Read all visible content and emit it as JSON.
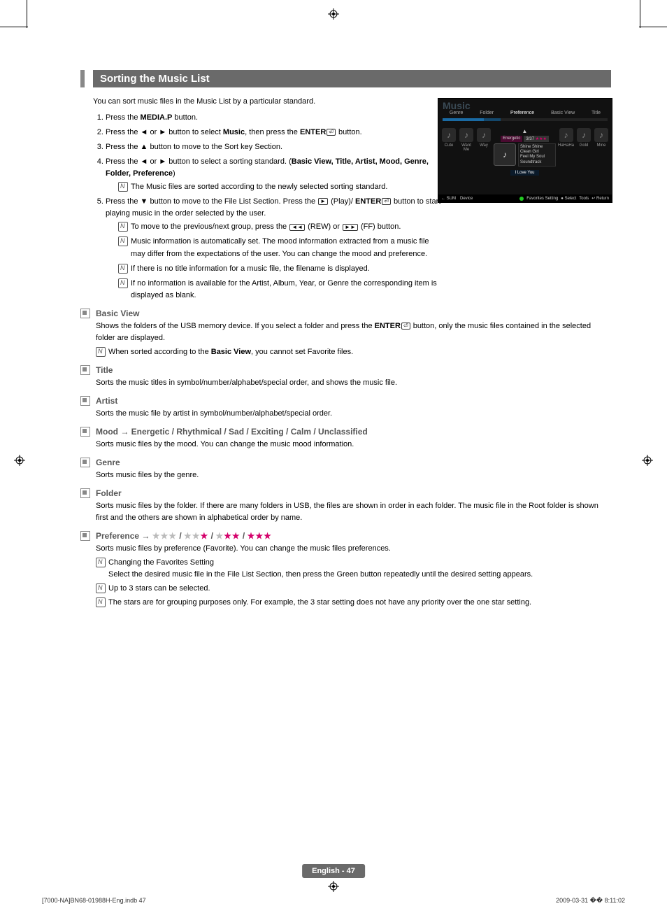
{
  "section_title": "Sorting the Music List",
  "intro": "You can sort music files in the Music List by a particular standard.",
  "steps": {
    "s1_a": "Press the ",
    "s1_b": "MEDIA.P",
    "s1_c": " button.",
    "s2_a": "Press the ◄ or ► button to select ",
    "s2_b": "Music",
    "s2_c": ", then press the ",
    "s2_d": "ENTER",
    "s2_e": " button.",
    "s3": "Press the ▲ button to move to the Sort key Section.",
    "s4_a": "Press the ◄ or ► button to select a sorting standard. (",
    "s4_b": "Basic View, Title, Artist, Mood, Genre, Folder, Preference",
    "s4_c": ")",
    "s4_note": "The Music files are sorted according to the newly selected sorting standard.",
    "s5_a": "Press the ▼ button to move to the File List Section. Press the ",
    "s5_b": " (Play)/ ",
    "s5_c": "ENTER",
    "s5_d": " button to start playing music in the order selected by the user.",
    "s5_n1_a": "To move to the previous/next group, press the ",
    "s5_n1_b": " (REW) or ",
    "s5_n1_c": " (FF) button.",
    "s5_n2": "Music information is automatically set. The mood information extracted from a music file may differ from the expectations of the user. You can change the mood and preference.",
    "s5_n3": "If there is no title information for a music file, the filename is displayed.",
    "s5_n4": "If no information is available for the Artist, Album, Year, or Genre the corresponding item is displayed as blank."
  },
  "subs": {
    "basic_view": {
      "title": "Basic View",
      "p_a": "Shows the folders of the USB memory device. If you select a folder and press the ",
      "p_b": "ENTER",
      "p_c": " button, only the music files contained in the selected folder are displayed.",
      "note_a": "When sorted according to the ",
      "note_b": "Basic View",
      "note_c": ", you cannot set Favorite files."
    },
    "title_sec": {
      "title": "Title",
      "p": "Sorts the music titles in symbol/number/alphabet/special order, and shows the music file."
    },
    "artist": {
      "title": "Artist",
      "p": "Sorts the music file by artist in symbol/number/alphabet/special order."
    },
    "mood": {
      "title": "Mood → Energetic / Rhythmical / Sad / Exciting / Calm / Unclassified",
      "p": "Sorts music files by the mood. You can change the music mood information."
    },
    "genre": {
      "title": "Genre",
      "p": "Sorts music files by the genre."
    },
    "folder": {
      "title": "Folder",
      "p": "Sorts music files by the folder. If there are many folders in USB, the files are shown in order in each folder. The music file in the Root folder is shown first and the others are shown in alphabetical order by name."
    },
    "pref": {
      "title_a": "Preference → ",
      "p": "Sorts music files by preference (Favorite). You can change the music files preferences.",
      "n1_a": "Changing the Favorites Setting",
      "n1_b": "Select the desired music file in the File List Section, then press the Green button repeatedly until the desired setting appears.",
      "n2": "Up to 3 stars can be selected.",
      "n3": "The stars are for grouping purposes only. For example, the 3 star setting does not have any priority over the one star setting."
    }
  },
  "screenshot": {
    "title": "Music",
    "tabs": [
      "Genre",
      "Folder",
      "Preference",
      "Basic View",
      "Title"
    ],
    "tags": {
      "left": "Energetic",
      "right": "3/37"
    },
    "songs": [
      "Shine Shine",
      "Clean Girl",
      "Feel My Soul",
      "Soundtrack"
    ],
    "now_playing": "I Love You",
    "cols": [
      "Cute",
      "Want Me",
      "Way",
      "HaHaHa",
      "Gold",
      "Mine"
    ],
    "footer_left": [
      "SUM",
      "Device"
    ],
    "footer_right": [
      "Favorites Setting",
      "Select",
      "Tools",
      "Return"
    ]
  },
  "page_label": "English - 47",
  "footer_left": "[7000-NA]BN68-01988H-Eng.indb   47",
  "footer_right": "2009-03-31   �� 8:11:02"
}
